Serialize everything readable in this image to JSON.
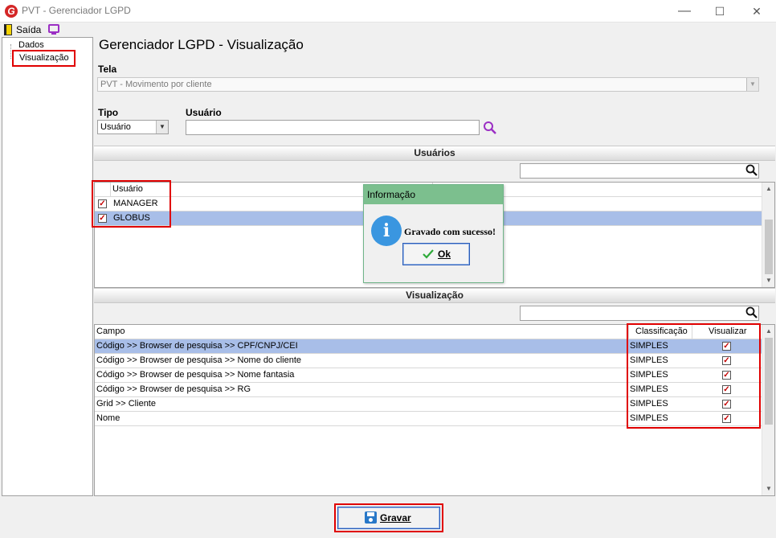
{
  "window": {
    "title": "PVT - Gerenciador LGPD",
    "app_icon": "G",
    "minimize": "—",
    "maximize": "☐",
    "close": "✕"
  },
  "menu": {
    "exit_label": "Saída"
  },
  "tree": {
    "items": [
      "Dados",
      "Visualização"
    ]
  },
  "page": {
    "title": "Gerenciador LGPD - Visualização"
  },
  "form": {
    "tela_label": "Tela",
    "tela_value": "PVT - Movimento por cliente",
    "tipo_label": "Tipo",
    "tipo_value": "Usuário",
    "usuario_label": "Usuário",
    "usuario_value": ""
  },
  "users_section": {
    "title": "Usuários",
    "column": "Usuário",
    "rows": [
      {
        "name": "MANAGER",
        "checked": true,
        "selected": false
      },
      {
        "name": "GLOBUS",
        "checked": true,
        "selected": true
      }
    ]
  },
  "view_section": {
    "title": "Visualização",
    "columns": [
      "Campo",
      "Classificação",
      "Visualizar"
    ],
    "rows": [
      {
        "campo": "Código >> Browser de pesquisa >> CPF/CNPJ/CEI",
        "classificacao": "SIMPLES",
        "visualizar": true,
        "selected": true
      },
      {
        "campo": "Código >> Browser de pesquisa >> Nome do cliente",
        "classificacao": "SIMPLES",
        "visualizar": true,
        "selected": false
      },
      {
        "campo": "Código >> Browser de pesquisa >> Nome fantasia",
        "classificacao": "SIMPLES",
        "visualizar": true,
        "selected": false
      },
      {
        "campo": "Código >> Browser de pesquisa >> RG",
        "classificacao": "SIMPLES",
        "visualizar": true,
        "selected": false
      },
      {
        "campo": "Grid >> Cliente",
        "classificacao": "SIMPLES",
        "visualizar": true,
        "selected": false
      },
      {
        "campo": "Nome",
        "classificacao": "SIMPLES",
        "visualizar": true,
        "selected": false
      }
    ]
  },
  "dialog": {
    "title": "Informação",
    "message": "Gravado com sucesso!",
    "ok_label": "Ok",
    "icon": "i"
  },
  "footer": {
    "save_label": "Gravar"
  },
  "glyphs": {
    "check": "✓",
    "arrow_down": "▼",
    "arrow_up": "▲"
  },
  "colors": {
    "highlight": "#e00000",
    "selection": "#a8bee8",
    "dialog_header": "#7cbf8e",
    "accent": "#2a5cb8"
  }
}
